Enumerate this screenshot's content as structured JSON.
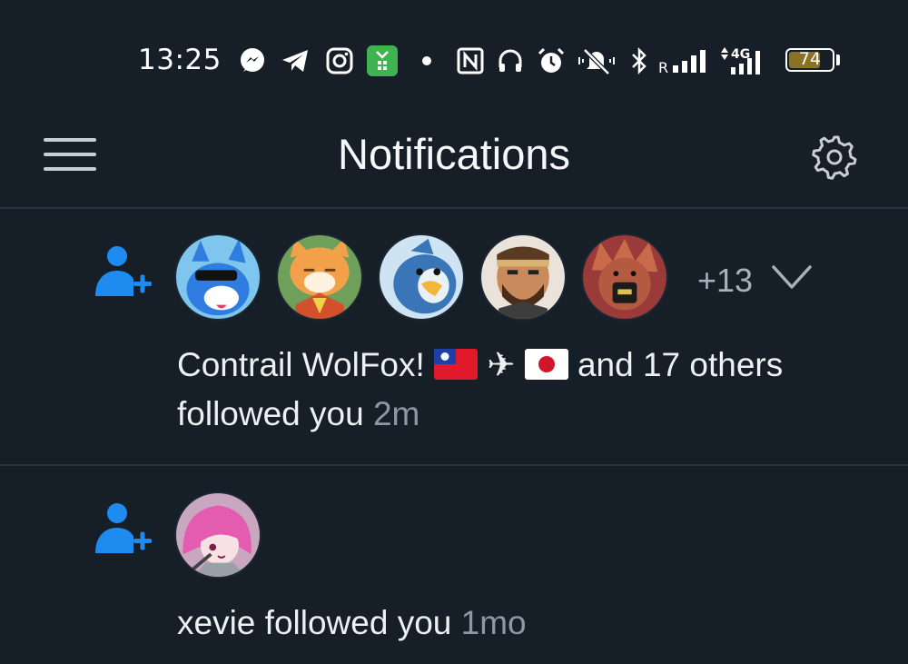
{
  "status_bar": {
    "time": "13:25",
    "battery": "74",
    "battery_level": 0.74,
    "icons": [
      "messenger-icon",
      "telegram-icon",
      "instagram-icon",
      "app-icon",
      "dot-icon",
      "nfc-icon",
      "headphones-icon",
      "alarm-icon",
      "mute-icon",
      "bluetooth-icon",
      "signal-roaming-icon",
      "signal-4g-icon",
      "battery-icon"
    ],
    "roaming": "R",
    "network": "4G"
  },
  "header": {
    "title": "Notifications",
    "menu_icon": "hamburger-menu-icon",
    "settings_icon": "gear-icon"
  },
  "notifications": [
    {
      "type": "follow",
      "icon": "person-add-icon",
      "more_count": "+13",
      "name": "Contrail WolFox!",
      "name_suffix_icons": [
        "taiwan-flag",
        "airplane",
        "japan-flag"
      ],
      "airplane": "✈",
      "rest": "and 17 others",
      "action": "followed you",
      "time": "2m"
    },
    {
      "type": "follow",
      "icon": "person-add-icon",
      "name": "xevie",
      "action": "followed you",
      "time": "1mo"
    }
  ],
  "colors": {
    "background": "#161e27",
    "accent_blue": "#1d8bf0",
    "muted_text": "#8e98a4",
    "divider": "#2a3440"
  }
}
